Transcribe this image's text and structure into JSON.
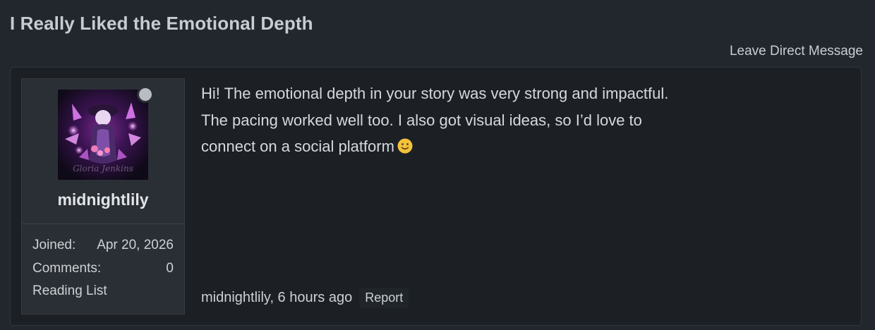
{
  "page": {
    "title": "I Really Liked the Emotional Depth",
    "dm_link": "Leave Direct Message"
  },
  "profile": {
    "username": "midnightlily",
    "avatar_signature": "Gloria Jenkins",
    "online_status_color": "#b9bcc0",
    "joined_label": "Joined:",
    "joined_value": "Apr 20, 2026",
    "comments_label": "Comments:",
    "comments_value": "0",
    "reading_list": "Reading List"
  },
  "message": {
    "lines": [
      "Hi! The emotional depth in your story was very strong and impactful.",
      "The pacing worked well too. I also got visual ideas, so I’d love to",
      "connect on a social platform"
    ],
    "emoji_icon": "slightly-smiling-face-icon"
  },
  "footer": {
    "author_time": "midnightlily, 6 hours ago",
    "report": "Report"
  }
}
